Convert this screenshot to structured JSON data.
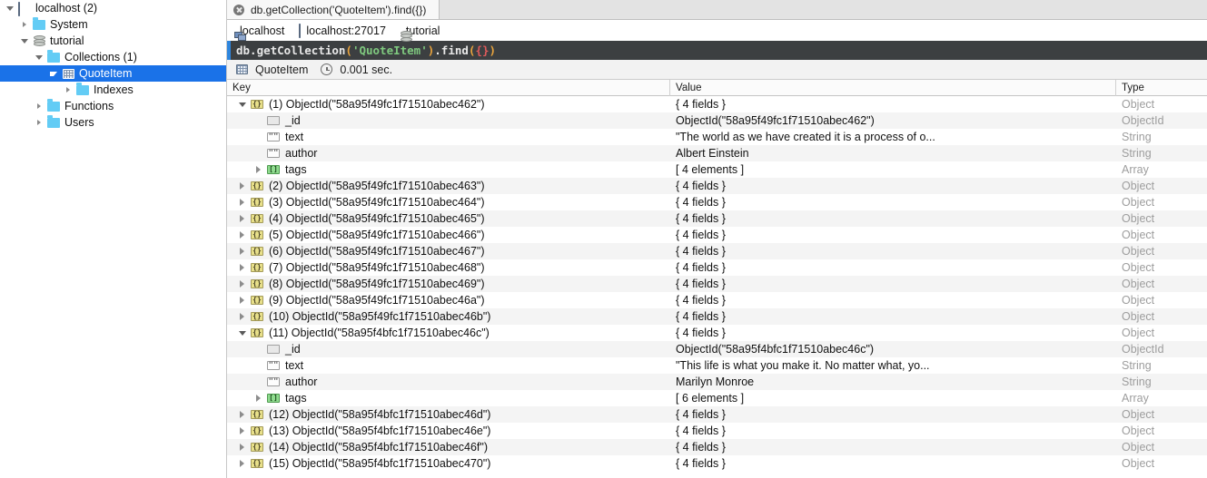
{
  "sidebar": {
    "items": [
      {
        "label": "localhost (2)",
        "icon": "computer-icon",
        "depth": 0,
        "twisty": "open",
        "selected": false
      },
      {
        "label": "System",
        "icon": "folder-icon",
        "depth": 1,
        "twisty": "closed",
        "selected": false
      },
      {
        "label": "tutorial",
        "icon": "database-icon",
        "depth": 1,
        "twisty": "open",
        "selected": false
      },
      {
        "label": "Collections (1)",
        "icon": "folder-icon",
        "depth": 2,
        "twisty": "open",
        "selected": false
      },
      {
        "label": "QuoteItem",
        "icon": "collection-grid-icon",
        "depth": 3,
        "twisty": "open",
        "selected": true
      },
      {
        "label": "Indexes",
        "icon": "folder-icon",
        "depth": 4,
        "twisty": "closed",
        "selected": false
      },
      {
        "label": "Functions",
        "icon": "folder-icon",
        "depth": 2,
        "twisty": "closed",
        "selected": false
      },
      {
        "label": "Users",
        "icon": "folder-icon",
        "depth": 2,
        "twisty": "closed",
        "selected": false
      }
    ]
  },
  "tabs": [
    {
      "label": "db.getCollection('QuoteItem').find({})",
      "active": true,
      "close_icon": "close-icon"
    }
  ],
  "breadcrumb": [
    {
      "label": "localhost",
      "icon": "server-icon"
    },
    {
      "label": "localhost:27017",
      "icon": "computer-icon"
    },
    {
      "label": "tutorial",
      "icon": "database-icon"
    }
  ],
  "query": {
    "prefix": "db.getCollection",
    "open_paren": "(",
    "string": "'QuoteItem'",
    "close_paren": ")",
    "dot_find": ".find",
    "open_paren2": "(",
    "braces": "{}",
    "close_paren2": ")",
    "full_text": "db.getCollection('QuoteItem').find({})"
  },
  "result_bar": {
    "collection_icon": "collection-grid-icon",
    "collection": "QuoteItem",
    "clock_icon": "clock-icon",
    "time": "0.001 sec."
  },
  "table": {
    "columns": [
      "Key",
      "Value",
      "Type"
    ],
    "rows": [
      {
        "depth": 0,
        "twisty": "open",
        "icon": "object-icon",
        "key": "(1) ObjectId(\"58a95f49fc1f71510abec462\")",
        "value": "{ 4 fields }",
        "type": "Object"
      },
      {
        "depth": 1,
        "twisty": "none",
        "icon": "objectid-icon",
        "key": "_id",
        "value": "ObjectId(\"58a95f49fc1f71510abec462\")",
        "type": "ObjectId"
      },
      {
        "depth": 1,
        "twisty": "none",
        "icon": "string-icon",
        "key": "text",
        "value": "\"The world as we have created it is a process of o...",
        "type": "String"
      },
      {
        "depth": 1,
        "twisty": "none",
        "icon": "string-icon",
        "key": "author",
        "value": "Albert Einstein",
        "type": "String"
      },
      {
        "depth": 1,
        "twisty": "closed",
        "icon": "array-icon",
        "key": "tags",
        "value": "[ 4 elements ]",
        "type": "Array"
      },
      {
        "depth": 0,
        "twisty": "closed",
        "icon": "object-icon",
        "key": "(2) ObjectId(\"58a95f49fc1f71510abec463\")",
        "value": "{ 4 fields }",
        "type": "Object"
      },
      {
        "depth": 0,
        "twisty": "closed",
        "icon": "object-icon",
        "key": "(3) ObjectId(\"58a95f49fc1f71510abec464\")",
        "value": "{ 4 fields }",
        "type": "Object"
      },
      {
        "depth": 0,
        "twisty": "closed",
        "icon": "object-icon",
        "key": "(4) ObjectId(\"58a95f49fc1f71510abec465\")",
        "value": "{ 4 fields }",
        "type": "Object"
      },
      {
        "depth": 0,
        "twisty": "closed",
        "icon": "object-icon",
        "key": "(5) ObjectId(\"58a95f49fc1f71510abec466\")",
        "value": "{ 4 fields }",
        "type": "Object"
      },
      {
        "depth": 0,
        "twisty": "closed",
        "icon": "object-icon",
        "key": "(6) ObjectId(\"58a95f49fc1f71510abec467\")",
        "value": "{ 4 fields }",
        "type": "Object"
      },
      {
        "depth": 0,
        "twisty": "closed",
        "icon": "object-icon",
        "key": "(7) ObjectId(\"58a95f49fc1f71510abec468\")",
        "value": "{ 4 fields }",
        "type": "Object"
      },
      {
        "depth": 0,
        "twisty": "closed",
        "icon": "object-icon",
        "key": "(8) ObjectId(\"58a95f49fc1f71510abec469\")",
        "value": "{ 4 fields }",
        "type": "Object"
      },
      {
        "depth": 0,
        "twisty": "closed",
        "icon": "object-icon",
        "key": "(9) ObjectId(\"58a95f49fc1f71510abec46a\")",
        "value": "{ 4 fields }",
        "type": "Object"
      },
      {
        "depth": 0,
        "twisty": "closed",
        "icon": "object-icon",
        "key": "(10) ObjectId(\"58a95f49fc1f71510abec46b\")",
        "value": "{ 4 fields }",
        "type": "Object"
      },
      {
        "depth": 0,
        "twisty": "open",
        "icon": "object-icon",
        "key": "(11) ObjectId(\"58a95f4bfc1f71510abec46c\")",
        "value": "{ 4 fields }",
        "type": "Object"
      },
      {
        "depth": 1,
        "twisty": "none",
        "icon": "objectid-icon",
        "key": "_id",
        "value": "ObjectId(\"58a95f4bfc1f71510abec46c\")",
        "type": "ObjectId"
      },
      {
        "depth": 1,
        "twisty": "none",
        "icon": "string-icon",
        "key": "text",
        "value": "\"This life is what you make it. No matter what, yo...",
        "type": "String"
      },
      {
        "depth": 1,
        "twisty": "none",
        "icon": "string-icon",
        "key": "author",
        "value": "Marilyn Monroe",
        "type": "String"
      },
      {
        "depth": 1,
        "twisty": "closed",
        "icon": "array-icon",
        "key": "tags",
        "value": "[ 6 elements ]",
        "type": "Array"
      },
      {
        "depth": 0,
        "twisty": "closed",
        "icon": "object-icon",
        "key": "(12) ObjectId(\"58a95f4bfc1f71510abec46d\")",
        "value": "{ 4 fields }",
        "type": "Object"
      },
      {
        "depth": 0,
        "twisty": "closed",
        "icon": "object-icon",
        "key": "(13) ObjectId(\"58a95f4bfc1f71510abec46e\")",
        "value": "{ 4 fields }",
        "type": "Object"
      },
      {
        "depth": 0,
        "twisty": "closed",
        "icon": "object-icon",
        "key": "(14) ObjectId(\"58a95f4bfc1f71510abec46f\")",
        "value": "{ 4 fields }",
        "type": "Object"
      },
      {
        "depth": 0,
        "twisty": "closed",
        "icon": "object-icon",
        "key": "(15) ObjectId(\"58a95f4bfc1f71510abec470\")",
        "value": "{ 4 fields }",
        "type": "Object"
      }
    ]
  },
  "colors": {
    "selection": "#1a72e8",
    "query_bg": "#3c3f41",
    "query_string": "#7fc97f",
    "query_paren": "#e8a33d",
    "query_brace": "#e05b5b",
    "row_alt": "#f4f4f4",
    "type_text": "#9d9d9d"
  }
}
